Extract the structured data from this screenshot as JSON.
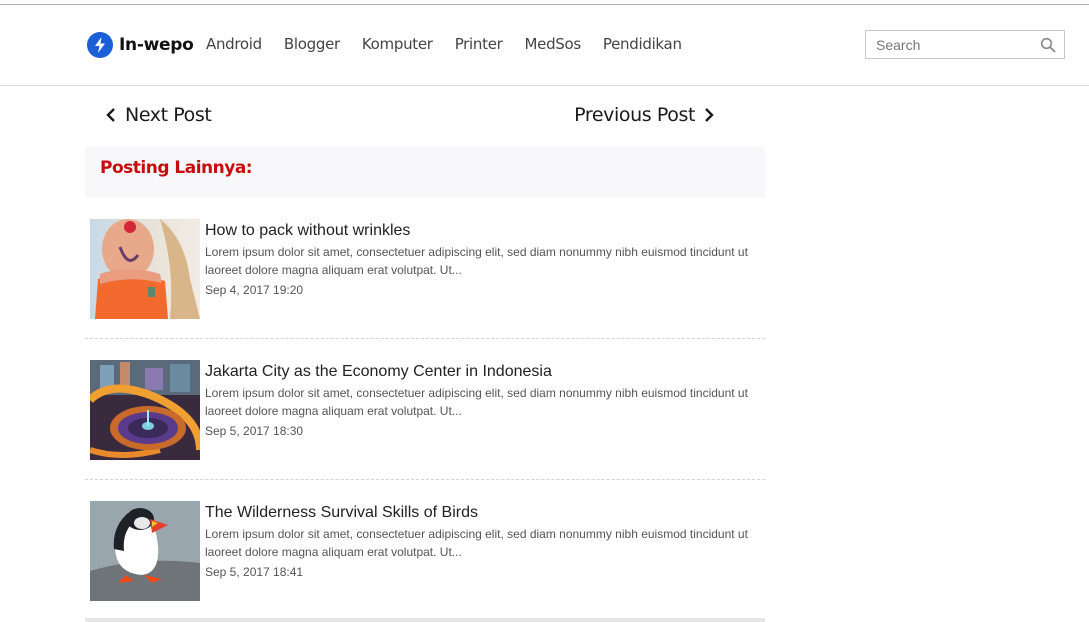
{
  "header": {
    "logo": {
      "icon": "lightning-bolt-icon",
      "text": "In-wepo",
      "brand_color": "#1a5fd8"
    },
    "nav": [
      {
        "label": "Android"
      },
      {
        "label": "Blogger"
      },
      {
        "label": "Komputer"
      },
      {
        "label": "Printer"
      },
      {
        "label": "MedSos"
      },
      {
        "label": "Pendidikan"
      }
    ],
    "search": {
      "placeholder": "Search",
      "value": "",
      "icon": "search-icon"
    }
  },
  "post_navigation": {
    "next_label": "Next Post",
    "previous_label": "Previous Post"
  },
  "related": {
    "title": "Posting Lainnya:",
    "title_color": "#c50d0d",
    "posts": [
      {
        "title": "How to pack without wrinkles",
        "excerpt": "Lorem ipsum dolor sit amet, consectetuer adipiscing elit, sed diam nonummy nibh euismod tincidunt ut laoreet dolore magna aliquam erat volutpat. Ut...",
        "date": "Sep 4, 2017 19:20",
        "thumbnail": "woman-orange-top-photo"
      },
      {
        "title": "Jakarta City as the Economy Center in Indonesia",
        "excerpt": "Lorem ipsum dolor sit amet, consectetuer adipiscing elit, sed diam nonummy nibh euismod tincidunt ut laoreet dolore magna aliquam erat volutpat. Ut...",
        "date": "Sep 5, 2017 18:30",
        "thumbnail": "city-roundabout-night-photo"
      },
      {
        "title": "The Wilderness Survival Skills of Birds",
        "excerpt": "Lorem ipsum dolor sit amet, consectetuer adipiscing elit, sed diam nonummy nibh euismod tincidunt ut laoreet dolore magna aliquam erat volutpat. Ut...",
        "date": "Sep 5, 2017 18:41",
        "thumbnail": "puffin-bird-photo"
      }
    ]
  }
}
